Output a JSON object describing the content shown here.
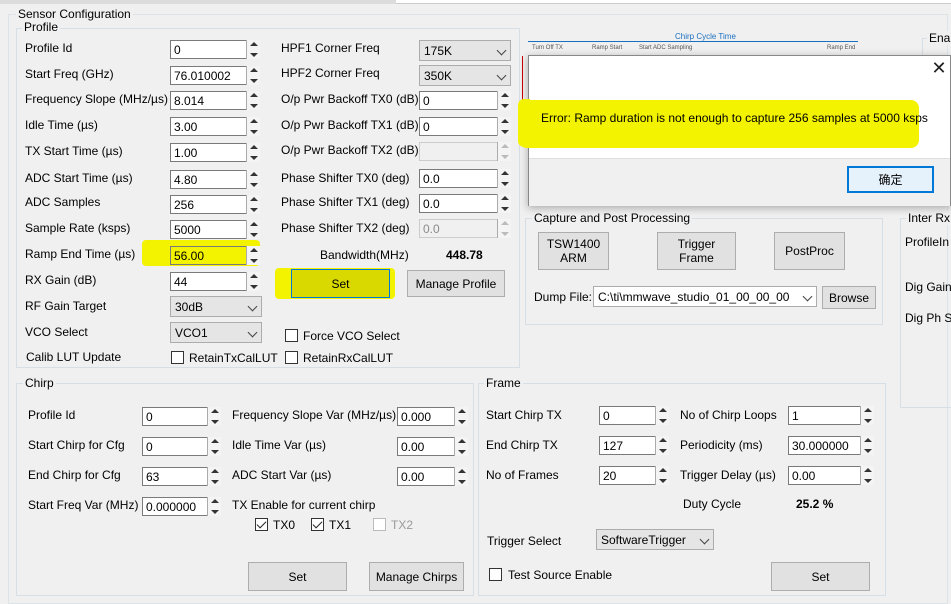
{
  "sensor_configuration": {
    "title": "Sensor Configuration",
    "profile": {
      "legend": "Profile",
      "profile_id": {
        "label": "Profile Id",
        "value": "0"
      },
      "start_freq": {
        "label": "Start Freq (GHz)",
        "value": "76.010002"
      },
      "freq_slope": {
        "label": "Frequency Slope (MHz/µs)",
        "value": "8.014"
      },
      "idle_time": {
        "label": "Idle Time (µs)",
        "value": "3.00"
      },
      "tx_start_time": {
        "label": "TX Start Time (µs)",
        "value": "1.00"
      },
      "adc_start_time": {
        "label": "ADC Start Time (µs)",
        "value": "4.80"
      },
      "adc_samples": {
        "label": "ADC Samples",
        "value": "256"
      },
      "sample_rate": {
        "label": "Sample Rate (ksps)",
        "value": "5000"
      },
      "ramp_end_time": {
        "label": "Ramp End Time (µs)",
        "value": "56.00"
      },
      "rx_gain": {
        "label": "RX Gain (dB)",
        "value": "44"
      },
      "rf_gain_target": {
        "label": "RF Gain Target",
        "value": "30dB"
      },
      "vco_select": {
        "label": "VCO Select",
        "value": "VCO1"
      },
      "calib_lut_update": {
        "label": "Calib LUT Update"
      },
      "retain_tx_cal_lut": {
        "label": "RetainTxCalLUT",
        "checked": false
      },
      "retain_rx_cal_lut": {
        "label": "RetainRxCalLUT",
        "checked": false
      },
      "force_vco_select": {
        "label": "Force VCO Select",
        "checked": false
      },
      "hpf1": {
        "label": "HPF1 Corner Freq",
        "value": "175K"
      },
      "hpf2": {
        "label": "HPF2 Corner Freq",
        "value": "350K"
      },
      "pwr_backoff_tx0": {
        "label": "O/p Pwr Backoff TX0 (dB)",
        "value": "0"
      },
      "pwr_backoff_tx1": {
        "label": "O/p Pwr Backoff TX1 (dB)",
        "value": "0"
      },
      "pwr_backoff_tx2": {
        "label": "O/p Pwr Backoff TX2 (dB)",
        "value": ""
      },
      "phase_tx0": {
        "label": "Phase Shifter TX0 (deg)",
        "value": "0.0"
      },
      "phase_tx1": {
        "label": "Phase Shifter TX1 (deg)",
        "value": "0.0"
      },
      "phase_tx2": {
        "label": "Phase Shifter TX2 (deg)",
        "value": "0.0"
      },
      "bandwidth": {
        "label": "Bandwidth(MHz)",
        "value": "448.78"
      },
      "set_label": "Set",
      "manage_profile_label": "Manage Profile"
    },
    "chirp": {
      "legend": "Chirp",
      "profile_id": {
        "label": "Profile Id",
        "value": "0"
      },
      "start_chirp": {
        "label": "Start Chirp for Cfg",
        "value": "0"
      },
      "end_chirp": {
        "label": "End Chirp for Cfg",
        "value": "63"
      },
      "start_freq_var": {
        "label": "Start Freq Var (MHz)",
        "value": "0.000000"
      },
      "freq_slope_var": {
        "label": "Frequency Slope Var (MHz/µs)",
        "value": "0.000"
      },
      "idle_time_var": {
        "label": "Idle Time Var (µs)",
        "value": "0.00"
      },
      "adc_start_var": {
        "label": "ADC Start Var (µs)",
        "value": "0.00"
      },
      "tx_enable_label": "TX Enable for current chirp",
      "tx0": {
        "label": "TX0",
        "checked": true
      },
      "tx1": {
        "label": "TX1",
        "checked": true
      },
      "tx2": {
        "label": "TX2",
        "checked": false
      },
      "set_label": "Set",
      "manage_chirps_label": "Manage Chirps"
    },
    "frame": {
      "legend": "Frame",
      "start_chirp_tx": {
        "label": "Start Chirp TX",
        "value": "0"
      },
      "end_chirp_tx": {
        "label": "End Chirp TX",
        "value": "127"
      },
      "num_frames": {
        "label": "No of Frames",
        "value": "20"
      },
      "num_chirp_loops": {
        "label": "No of Chirp Loops",
        "value": "1"
      },
      "periodicity": {
        "label": "Periodicity (ms)",
        "value": "30.000000"
      },
      "trigger_delay": {
        "label": "Trigger Delay (µs)",
        "value": "0.00"
      },
      "duty_cycle": {
        "label": "Duty Cycle",
        "value": "25.2 %"
      },
      "trigger_select": {
        "label": "Trigger Select",
        "value": "SoftwareTrigger"
      },
      "test_source": {
        "label": "Test Source Enable",
        "checked": false
      },
      "set_label": "Set"
    },
    "capture": {
      "legend": "Capture and Post Processing",
      "tsw_label": "TSW1400\nARM",
      "trigger_frame_label": "Trigger\nFrame",
      "postproc_label": "PostProc",
      "dump_file_label": "Dump File:",
      "dump_file_value": "C:\\ti\\mmwave_studio_01_00_00_00",
      "browse_label": "Browse"
    },
    "diagram": {
      "title": "Chirp Cycle Time",
      "labels": [
        "Turn Off TX",
        "Ramp Start",
        "Start ADC Sampling",
        "Ramp End"
      ]
    },
    "right_panel": {
      "ena_label": "Ena",
      "inter_rx_legend": "Inter Rx",
      "profile_in": "ProfileIn",
      "dig_gain": "Dig Gain",
      "dig_ph": "Dig Ph S"
    }
  },
  "dialog": {
    "message": "Error: Ramp duration is not enough to capture 256 samples at 5000 ksps",
    "ok_label": "确定"
  }
}
